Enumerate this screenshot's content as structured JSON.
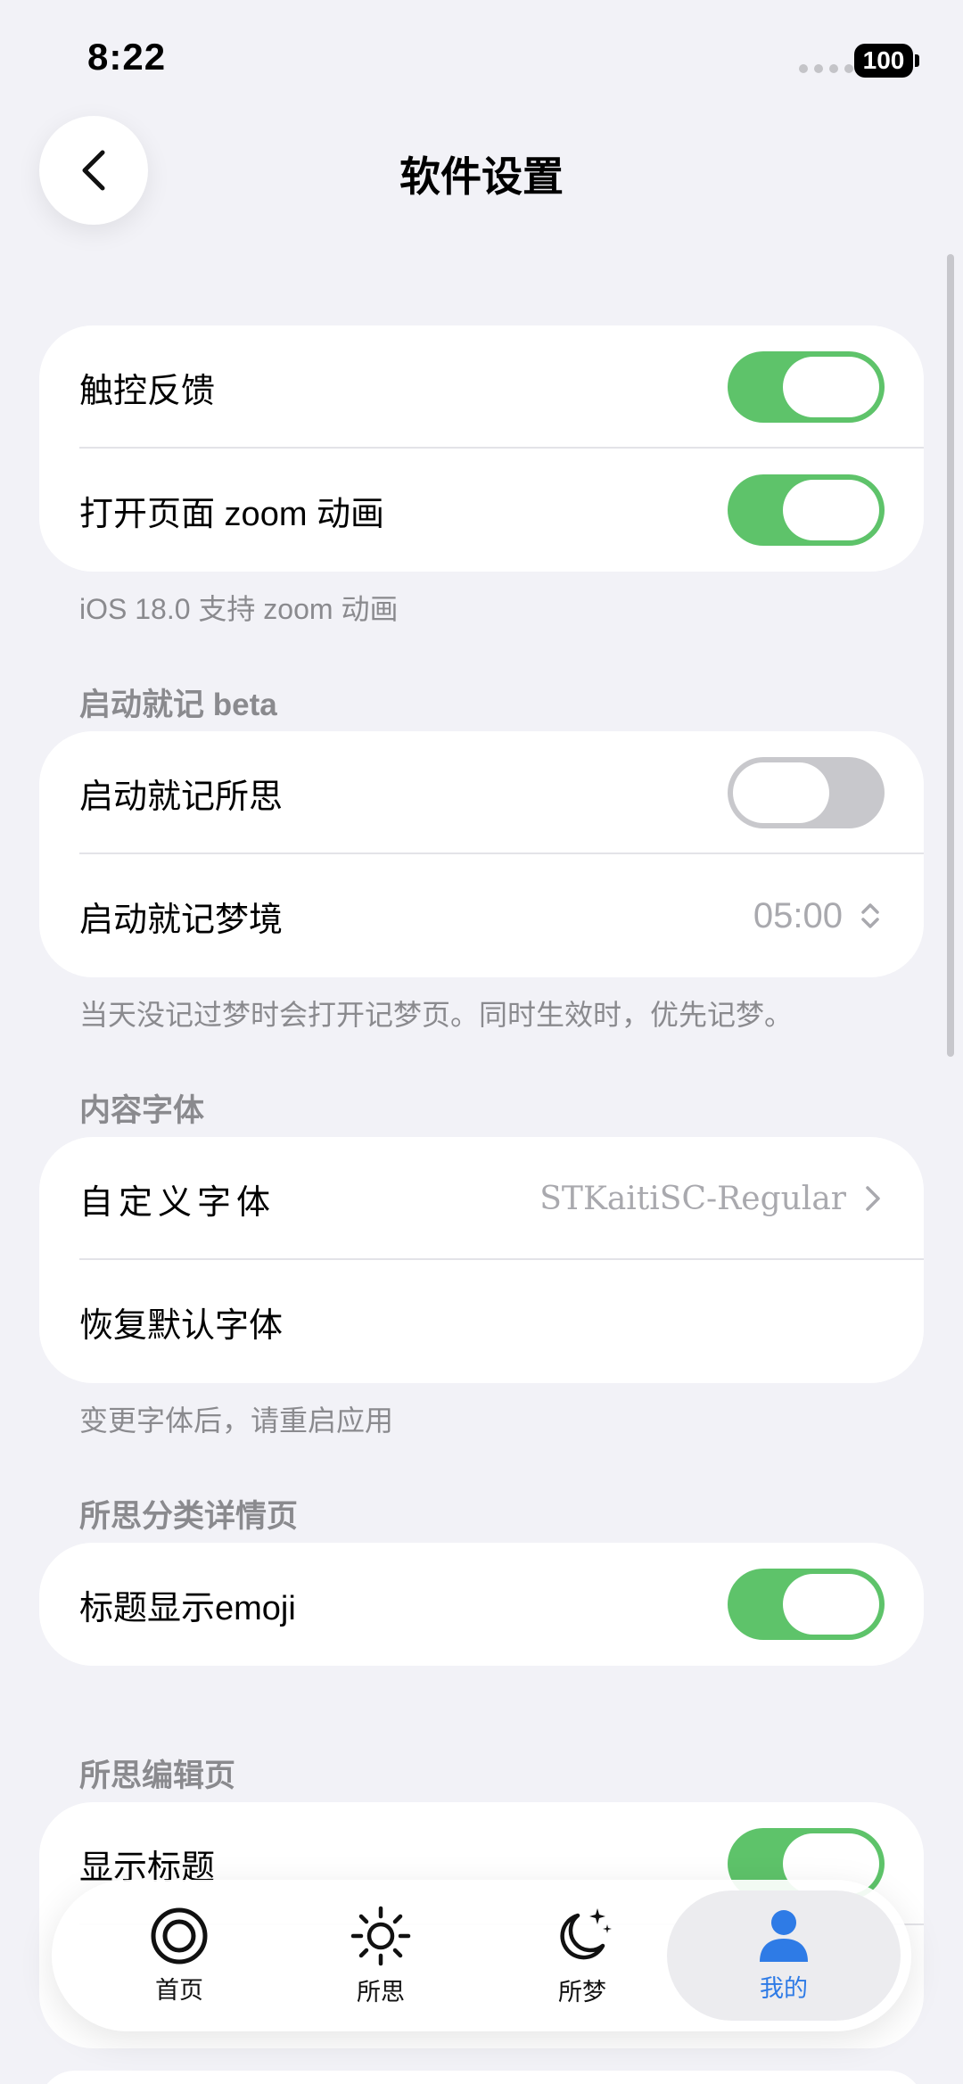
{
  "status_bar": {
    "time": "8:22",
    "battery": "100"
  },
  "header": {
    "title": "软件设置"
  },
  "sections": {
    "general": {
      "rows": [
        {
          "label": "触控反馈",
          "toggle": "on"
        },
        {
          "label": "打开页面 zoom 动画",
          "toggle": "on"
        }
      ],
      "footer": "iOS 18.0 支持 zoom 动画"
    },
    "launch": {
      "header": "启动就记 beta",
      "rows": [
        {
          "label": "启动就记所思",
          "toggle": "off"
        },
        {
          "label": "启动就记梦境",
          "value": "05:00"
        }
      ],
      "footer": "当天没记过梦时会打开记梦页。同时生效时，优先记梦。"
    },
    "font": {
      "header": "内容字体",
      "rows": [
        {
          "label": "自定义字体",
          "value": "STKaitiSC-Regular"
        },
        {
          "label": "恢复默认字体"
        }
      ],
      "footer": "变更字体后，请重启应用"
    },
    "category": {
      "header": "所思分类详情页",
      "rows": [
        {
          "label": "标题显示emoji",
          "toggle": "on"
        }
      ]
    },
    "editor": {
      "header": "所思编辑页",
      "rows": [
        {
          "label": "显示标题",
          "toggle": "on"
        }
      ]
    }
  },
  "tabbar": {
    "items": [
      {
        "label": "首页",
        "icon": "target-icon"
      },
      {
        "label": "所思",
        "icon": "sun-icon"
      },
      {
        "label": "所梦",
        "icon": "moon-stars-icon"
      },
      {
        "label": "我的",
        "icon": "person-icon",
        "active": true
      }
    ]
  },
  "colors": {
    "accent": "#2e7be6",
    "toggle_on": "#5ec36a",
    "toggle_off": "#c8c8cc",
    "background": "#f2f2f7"
  }
}
